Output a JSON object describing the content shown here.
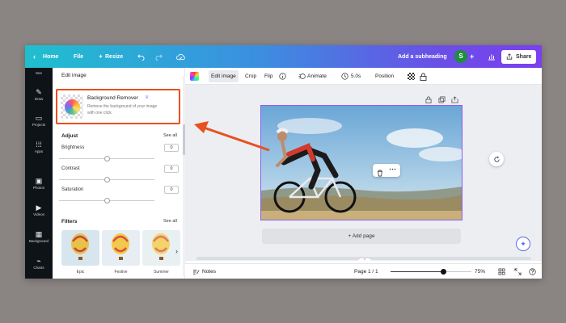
{
  "topbar": {
    "home": "Home",
    "file": "File",
    "resize": "Resize",
    "add_subheading": "Add a subheading",
    "avatar_initial": "S",
    "share": "Share"
  },
  "rail": {
    "items": [
      {
        "label": "See",
        "icon": "dots-icon"
      },
      {
        "label": "Draw",
        "icon": "draw-icon"
      },
      {
        "label": "Projects",
        "icon": "folder-icon"
      },
      {
        "label": "Apps",
        "icon": "apps-icon"
      },
      {
        "label": "Photos",
        "icon": "photos-icon"
      },
      {
        "label": "Videos",
        "icon": "videos-icon"
      },
      {
        "label": "Background",
        "icon": "background-icon"
      },
      {
        "label": "Charts",
        "icon": "charts-icon"
      }
    ]
  },
  "panel": {
    "title": "Edit image",
    "bg_remover": {
      "title": "Background Remover",
      "desc_line1": "Remove the background of your image",
      "desc_line2": "with one click."
    },
    "adjust": {
      "title": "Adjust",
      "see_all": "See all",
      "rows": [
        {
          "label": "Brightness",
          "value": "0",
          "level": 0.5
        },
        {
          "label": "Contrast",
          "value": "0",
          "level": 0.5
        },
        {
          "label": "Saturation",
          "value": "0",
          "level": 0.5
        }
      ]
    },
    "filters": {
      "title": "Filters",
      "see_all": "See all",
      "items": [
        "Epic",
        "Festive",
        "Summer"
      ]
    }
  },
  "context_toolbar": {
    "edit_image": "Edit image",
    "crop": "Crop",
    "flip": "Flip",
    "animate": "Animate",
    "duration": "5.0s",
    "position": "Position"
  },
  "canvas": {
    "add_page": "+ Add page"
  },
  "footer": {
    "notes": "Notes",
    "page": "Page 1 / 1",
    "zoom": "75%",
    "zoom_level": 0.65
  },
  "colors": {
    "highlight_box": "#e8501f",
    "arrow": "#e8501f",
    "selection": "#8b5cf6",
    "avatar": "#1e8e3e"
  }
}
